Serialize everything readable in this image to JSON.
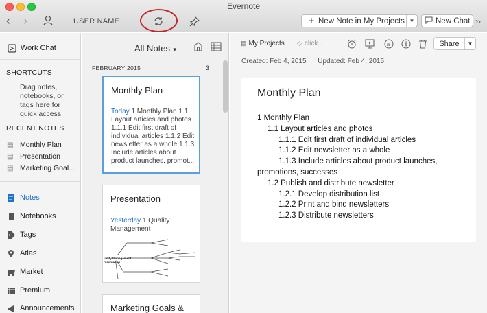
{
  "window": {
    "title": "Evernote"
  },
  "toolbar": {
    "username": "USER NAME",
    "new_note_label": "New Note in My Projects",
    "new_chat_label": "New Chat"
  },
  "sidebar": {
    "work_chat": "Work Chat",
    "shortcuts_heading": "SHORTCUTS",
    "shortcuts_hint": "Drag notes, notebooks, or tags here for quick access",
    "recent_heading": "RECENT NOTES",
    "recent_notes": [
      "Monthly Plan",
      "Presentation",
      "Marketing Goal..."
    ],
    "nav": [
      {
        "label": "Notes",
        "active": true
      },
      {
        "label": "Notebooks",
        "active": false
      },
      {
        "label": "Tags",
        "active": false
      },
      {
        "label": "Atlas",
        "active": false
      },
      {
        "label": "Market",
        "active": false
      },
      {
        "label": "Premium",
        "active": false
      },
      {
        "label": "Announcements",
        "active": false
      }
    ]
  },
  "notelist": {
    "title": "All Notes",
    "month": "FEBRUARY 2015",
    "count": "3",
    "cards": [
      {
        "title": "Monthly Plan",
        "date": "Today",
        "snippet": " 1 Monthly Plan 1.1 Layout articles and photos 1.1.1 Edit first draft of individual articles 1.1.2 Edit newsletter as a whole 1.1.3 Include articles about product launches, promot..."
      },
      {
        "title": "Presentation",
        "date": "Yesterday",
        "snippet": " 1 Quality Management Presentation..."
      },
      {
        "title": "Marketing Goals &",
        "date": "",
        "snippet": ""
      }
    ]
  },
  "editor": {
    "notebook": "My Projects",
    "tag_placeholder": "click...",
    "share_label": "Share",
    "created": "Created: Feb 4, 2015",
    "updated": "Updated: Feb 4, 2015",
    "note_title": "Monthly Plan",
    "lines": [
      {
        "text": "1 Monthly Plan",
        "indent": 0
      },
      {
        "text": "1.1 Layout articles and photos",
        "indent": 1
      },
      {
        "text": "1.1.1 Edit first draft of individual articles",
        "indent": 2
      },
      {
        "text": "1.1.2 Edit newsletter as a whole",
        "indent": 2
      },
      {
        "text": "1.1.3 Include articles about product launches,",
        "indent": 2
      },
      {
        "text": "promotions, successes",
        "indent": 0
      },
      {
        "text": "1.2 Publish and distribute newsletter",
        "indent": 1
      },
      {
        "text": "1.2.1 Develop distribution list",
        "indent": 2
      },
      {
        "text": "1.2.2 Print and bind newsletters",
        "indent": 2
      },
      {
        "text": "1.2.3 Distribute newsletters",
        "indent": 2
      }
    ]
  },
  "colors": {
    "accent_blue": "#1e73c8",
    "selection_border": "#5aa0dc",
    "highlight_ring": "#c0282a"
  }
}
